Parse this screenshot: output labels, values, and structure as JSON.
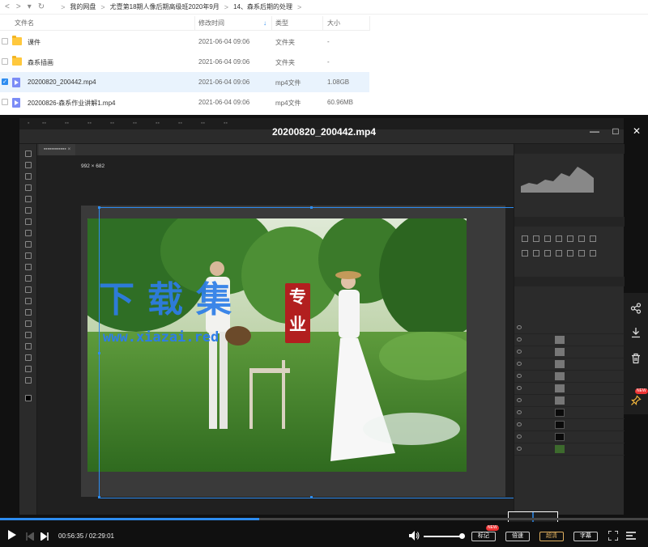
{
  "file_browser": {
    "nav": {
      "back": "<",
      "forward": ">",
      "dropdown": "▾",
      "refresh": "↻"
    },
    "breadcrumbs": [
      "我的网盘",
      "尤壹第18期人像后期高级班2020年9月",
      "14、森系后期的处理"
    ],
    "breadcrumb_sep": ">",
    "columns": {
      "name": "文件名",
      "date": "修改时间",
      "type": "类型",
      "size": "大小",
      "sort_indicator": "↓"
    },
    "rows": [
      {
        "name": "课件",
        "date": "2021-06-04 09:06",
        "type": "文件夹",
        "size": "-",
        "icon": "folder",
        "selected": false
      },
      {
        "name": "森系插画",
        "date": "2021-06-04 09:06",
        "type": "文件夹",
        "size": "-",
        "icon": "folder",
        "selected": false
      },
      {
        "name": "20200820_200442.mp4",
        "date": "2021-06-04 09:06",
        "type": "mp4文件",
        "size": "1.08GB",
        "icon": "video",
        "selected": true
      },
      {
        "name": "20200826-森系作业讲解1.mp4",
        "date": "2021-06-04 09:06",
        "type": "mp4文件",
        "size": "60.96MB",
        "icon": "video",
        "selected": false
      }
    ]
  },
  "player": {
    "title": "20200820_200442.mp4",
    "window_controls": {
      "minimize": "—",
      "maximize": "□",
      "close": "✕"
    },
    "video_content": {
      "canvas_dimensions": "992 × 682",
      "watermark_text": "下载集",
      "watermark_url": "www.xiazai.red",
      "watermark_seal": "专业"
    },
    "side_actions": {
      "share": "share-icon",
      "download": "download-icon",
      "delete": "trash-icon",
      "pin": "pin-icon",
      "pin_badge": "NEW"
    },
    "progress": 0.4,
    "controls": {
      "current_time": "00:56:35",
      "duration": "02:29:01",
      "time_sep": "/",
      "volume": 0.9,
      "buttons": [
        {
          "label": "标记",
          "badge": "NEW"
        },
        {
          "label": "倍速"
        },
        {
          "label": "超清"
        },
        {
          "label": "字幕"
        }
      ]
    },
    "colors": {
      "accent": "#2d8cf0",
      "watermark": "#2d7de8",
      "seal": "#b21f1f"
    }
  }
}
